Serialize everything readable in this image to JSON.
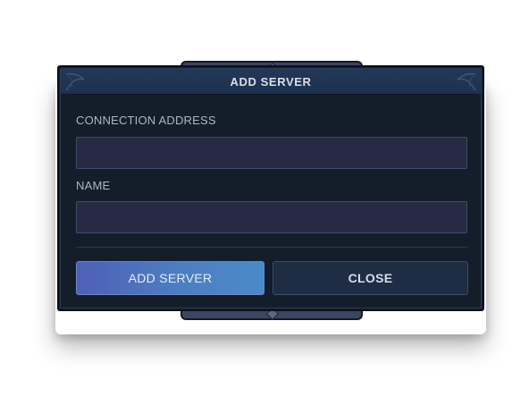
{
  "dialog": {
    "title": "ADD SERVER",
    "fields": {
      "address": {
        "label": "CONNECTION ADDRESS",
        "value": "",
        "placeholder": ""
      },
      "name": {
        "label": "NAME",
        "value": "",
        "placeholder": ""
      }
    },
    "buttons": {
      "add_label": "ADD SERVER",
      "close_label": "CLOSE"
    }
  },
  "colors": {
    "panel_background": "#141e2b",
    "title_bar": "#1d3150",
    "input_background": "#262a45",
    "primary_button": "#4c7ec2",
    "secondary_button": "#1f2d44",
    "text": "#d9dfe9",
    "label_text": "#aab6c6"
  },
  "icons": [
    "corner-ornament-icon",
    "frame-gem-icon"
  ]
}
